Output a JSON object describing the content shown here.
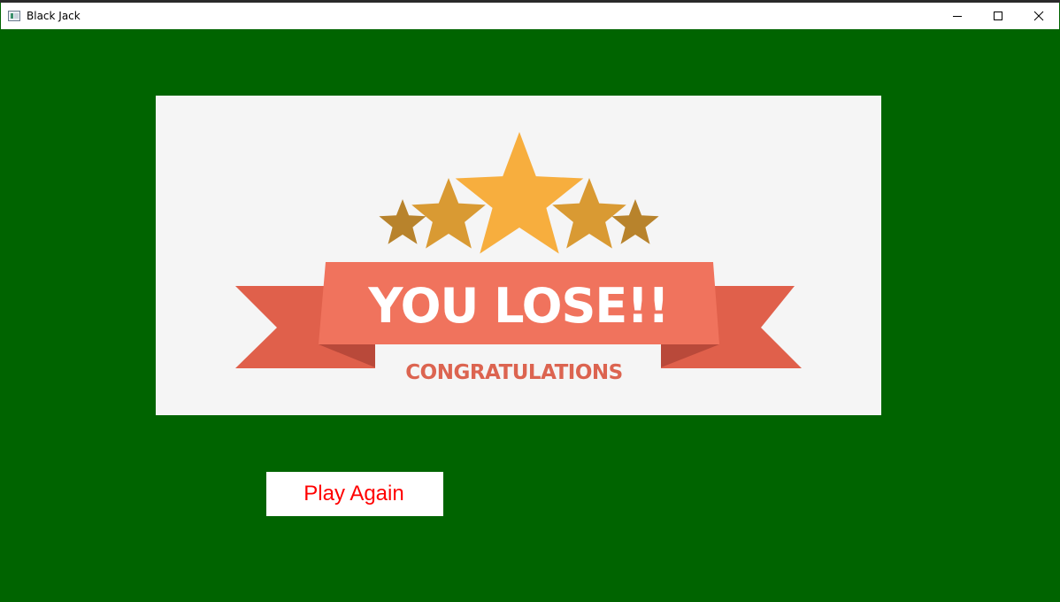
{
  "window": {
    "title": "Black Jack",
    "controls": {
      "minimize": "minimize-icon",
      "maximize": "maximize-icon",
      "close": "close-icon"
    }
  },
  "banner": {
    "headline": "YOU LOSE!!",
    "subtitle": "CONGRATULATIONS",
    "star_count": 5
  },
  "actions": {
    "play_again_label": "Play Again"
  },
  "colors": {
    "table_green": "#006400",
    "banner_bg": "#f5f5f5",
    "ribbon_main": "#f0735d",
    "ribbon_tail": "#e0604b",
    "ribbon_fold": "#b9493a",
    "star_center": "#f7ae3e",
    "star_mid": "#d99a33",
    "star_outer": "#b8832c",
    "button_text": "#ff0000"
  }
}
